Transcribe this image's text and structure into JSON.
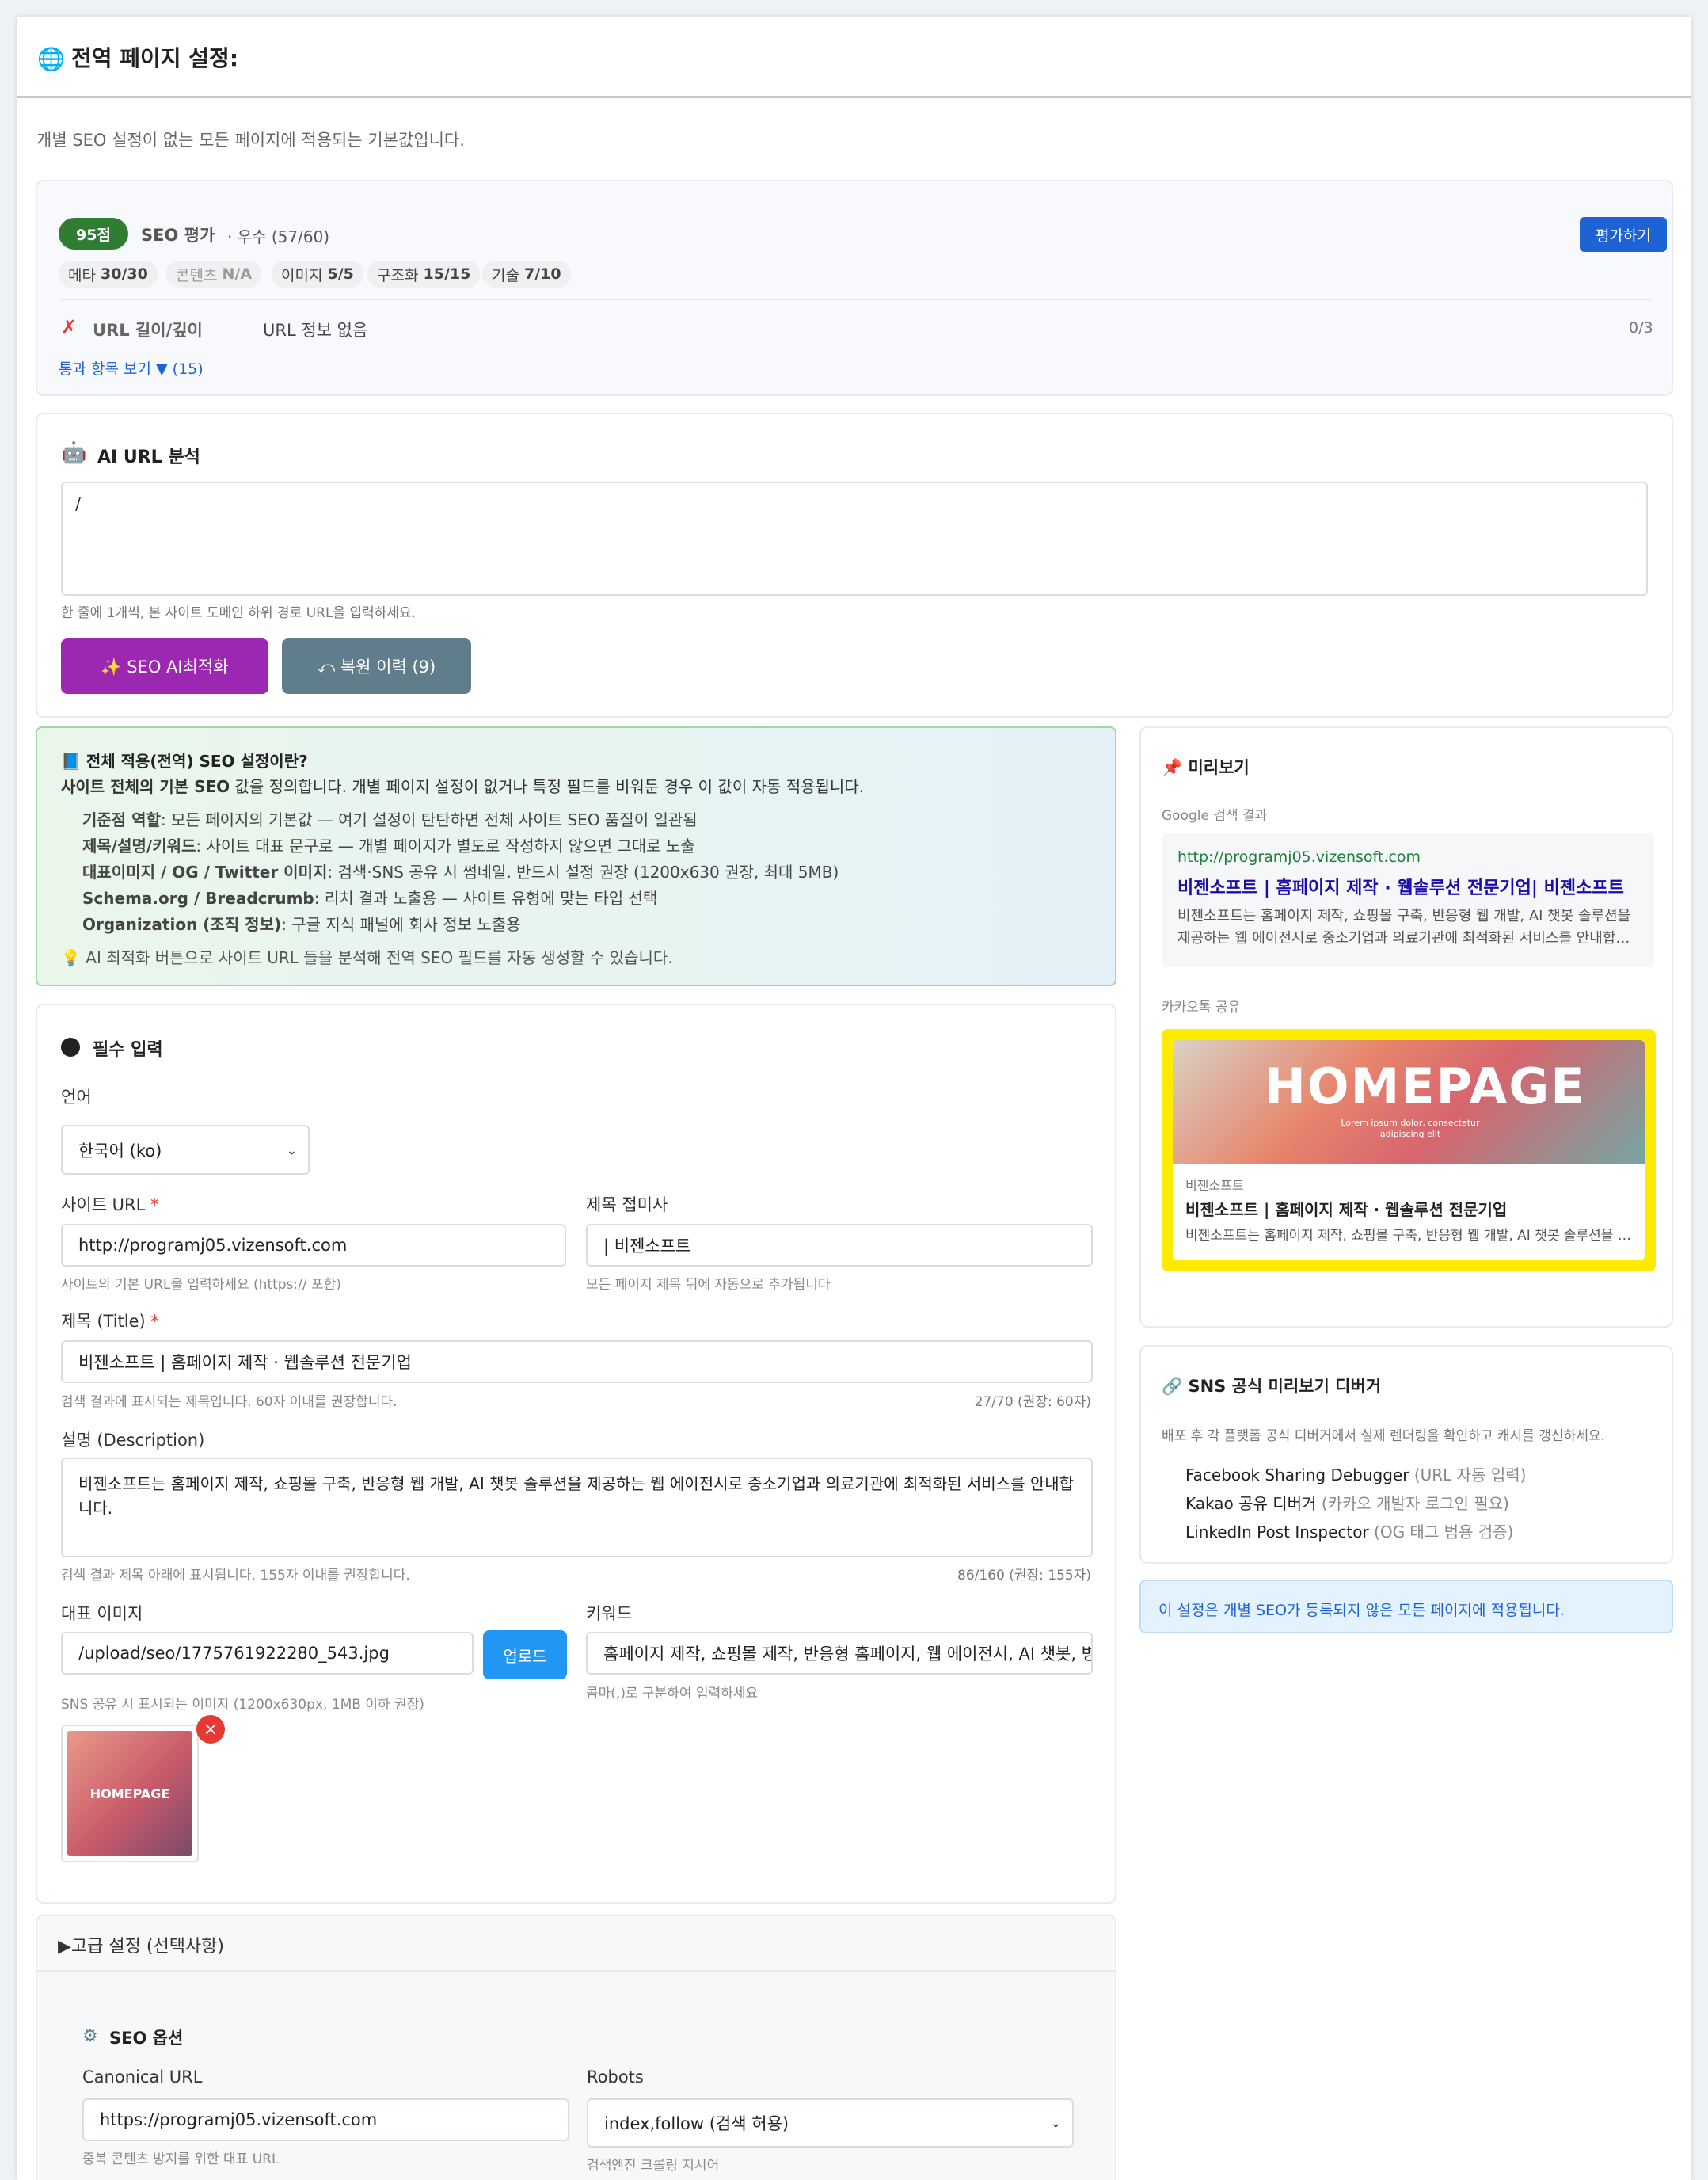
{
  "header": {
    "title": "전역 페이지 설정:",
    "subtitle": "개별 SEO 설정이 없는 모든 페이지에 적용되는 기본값입니다."
  },
  "seo_eval": {
    "score_badge": "95점",
    "label": "SEO 평가",
    "grade": "· 우수 (57/60)",
    "button": "평가하기",
    "pills": [
      {
        "name": "메타",
        "value": "30/30"
      },
      {
        "name": "콘텐츠",
        "value": "N/A"
      },
      {
        "name": "이미지",
        "value": "5/5"
      },
      {
        "name": "구조화",
        "value": "15/15"
      },
      {
        "name": "기술",
        "value": "7/10"
      }
    ],
    "fail_item": {
      "mark": "✗",
      "name": "URL 길이/깊이",
      "detail": "URL 정보 없음",
      "score": "0/3"
    },
    "passed_link": "통과 항목 보기 ▼ (15)"
  },
  "ai": {
    "title": "AI URL 분석",
    "textarea_value": "/",
    "hint": "한 줄에 1개씩, 본 사이트 도메인 하위 경로 URL을 입력하세요.",
    "optimize_button": "✨ SEO AI최적화",
    "history_button": "⤺ 복원 이력 (9)"
  },
  "info": {
    "title": "📘 전체 적용(전역) SEO 설정이란?",
    "lead_bold": "사이트 전체의 기본 SEO",
    "lead_rest": " 값을 정의합니다. 개별 페이지 설정이 없거나 특정 필드를 비워둔 경우 이 값이 자동 적용됩니다.",
    "items": [
      {
        "bold": "기준점 역할",
        "rest": ": 모든 페이지의 기본값 — 여기 설정이 탄탄하면 전체 사이트 SEO 품질이 일관됨"
      },
      {
        "bold": "제목/설명/키워드",
        "rest": ": 사이트 대표 문구로 — 개별 페이지가 별도로 작성하지 않으면 그대로 노출"
      },
      {
        "bold": "대표이미지 / OG / Twitter 이미지",
        "rest": ": 검색·SNS 공유 시 썸네일. 반드시 설정 권장 (1200x630 권장, 최대 5MB)"
      },
      {
        "bold": "Schema.org / Breadcrumb",
        "rest": ": 리치 결과 노출용 — 사이트 유형에 맞는 타입 선택"
      },
      {
        "bold": "Organization (조직 정보)",
        "rest": ": 구글 지식 패널에 회사 정보 노출용"
      }
    ],
    "tip": "💡 AI 최적화 버튼으로 사이트 URL 들을 분석해 전역 SEO 필드를 자동 생성할 수 있습니다."
  },
  "form": {
    "section_title": "필수 입력",
    "language_label": "언어",
    "language_value": "한국어 (ko)",
    "site_url_label": "사이트 URL",
    "site_url_value": "http://programj05.vizensoft.com",
    "site_url_hint": "사이트의 기본 URL을 입력하세요 (https:// 포함)",
    "suffix_label": "제목 접미사",
    "suffix_value": "| 비젠소프트",
    "suffix_hint": "모든 페이지 제목 뒤에 자동으로 추가됩니다",
    "title_label": "제목 (Title)",
    "title_value": "비젠소프트 | 홈페이지 제작 · 웹솔루션 전문기업",
    "title_hint": "검색 결과에 표시되는 제목입니다. 60자 이내를 권장합니다.",
    "title_count": "27/70 (권장: 60자)",
    "desc_label": "설명 (Description)",
    "desc_value": "비젠소프트는 홈페이지 제작, 쇼핑몰 구축, 반응형 웹 개발, AI 챗봇 솔루션을 제공하는 웹 에이전시로 중소기업과 의료기관에 최적화된 서비스를 안내합니다.",
    "desc_hint": "검색 결과 제목 아래에 표시됩니다. 155자 이내를 권장합니다.",
    "desc_count": "86/160 (권장: 155자)",
    "image_label": "대표 이미지",
    "image_value": "/upload/seo/1775761922280_543.jpg",
    "upload_button": "업로드",
    "image_hint": "SNS 공유 시 표시되는 이미지 (1200x630px, 1MB 이하 권장)",
    "thumb_text": "HOMEPAGE",
    "remove_icon": "×",
    "keywords_label": "키워드",
    "keywords_value": "홈페이지 제작, 쇼핑몰 제작, 반응형 홈페이지, 웹 에이전시, AI 챗봇, 병원",
    "keywords_hint": "콤마(,)로 구분하여 입력하세요"
  },
  "advanced": {
    "toggle": "▶고급 설정 (선택사항)",
    "section_title": "SEO 옵션",
    "canonical_label": "Canonical URL",
    "canonical_value": "https://programj05.vizensoft.com",
    "canonical_hint": "중복 콘텐츠 방지를 위한 대표 URL",
    "robots_label": "Robots",
    "robots_value": "index,follow (검색 허용)",
    "robots_hint": "검색엔진 크롤링 지시어"
  },
  "preview": {
    "title": "📌 미리보기",
    "google_label": "Google 검색 결과",
    "google_url": "http://programj05.vizensoft.com",
    "google_title": "비젠소프트 | 홈페이지 제작 · 웹솔루션 전문기업| 비젠소프트",
    "google_desc": "비젠소프트는 홈페이지 제작, 쇼핑몰 구축, 반응형 웹 개발, AI 챗봇 솔루션을 제공하는 웹 에이전시로 중소기업과 의료기관에 최적화된 서비스를 안내합…",
    "kakao_label": "카카오톡 공유",
    "kakao_image_text": "HOMEPAGE",
    "kakao_image_sub": "Lorem ipsum dolor, consectetur adipiscing elit",
    "kakao_site": "비젠소프트",
    "kakao_title": "비젠소프트 | 홈페이지 제작 · 웹솔루션 전문기업",
    "kakao_desc": "비젠소프트는 홈페이지 제작, 쇼핑몰 구축, 반응형 웹 개발, AI 챗봇 솔루션을 …"
  },
  "sns": {
    "title": "🔗 SNS 공식 미리보기 디버거",
    "desc": "배포 후 각 플랫폼 공식 디버거에서 실제 렌더링을 확인하고 캐시를 갱신하세요.",
    "links": [
      {
        "name": "Facebook Sharing Debugger",
        "note": " (URL 자동 입력)"
      },
      {
        "name": "Kakao 공유 디버거",
        "note": " (카카오 개발자 로그인 필요)"
      },
      {
        "name": "LinkedIn Post Inspector",
        "note": " (OG 태그 범용 검증)"
      }
    ]
  },
  "notice": "이 설정은 개별 SEO가 등록되지 않은 모든 페이지에 적용됩니다.",
  "colors": {
    "accent": "#1e63d6",
    "success": "#2e7d32",
    "purple": "#9c27b0",
    "slate": "#607d8b",
    "kakao": "#ffeb00"
  }
}
